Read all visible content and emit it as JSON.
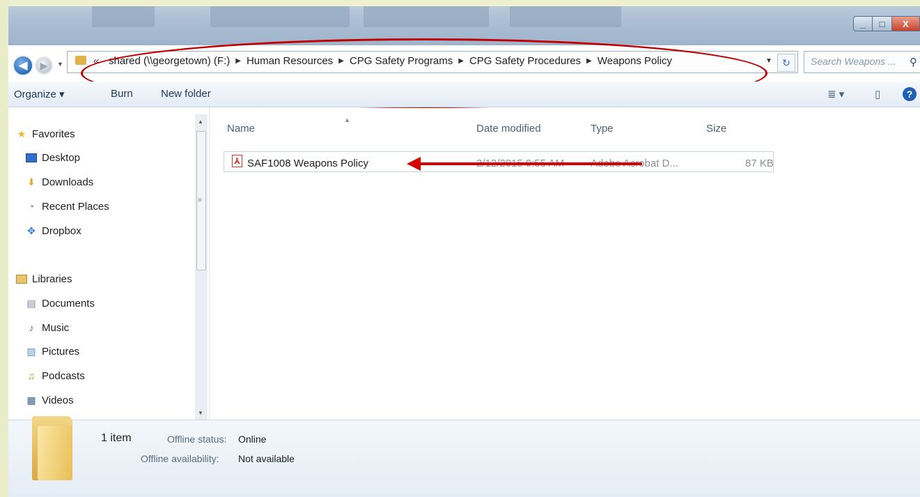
{
  "address": {
    "chevrons": "«",
    "segments": [
      "shared (\\\\georgetown) (F:)",
      "Human Resources",
      "CPG Safety Programs",
      "CPG Safety Procedures",
      "Weapons Policy"
    ],
    "search_placeholder": "Search Weapons ..."
  },
  "window_controls": {
    "minimize": "_",
    "maximize": "□",
    "close": "X"
  },
  "toolbar": {
    "organize": "Organize ▾",
    "burn": "Burn",
    "new_folder": "New folder",
    "views": "≣ ▾",
    "preview": "▯",
    "help": "?"
  },
  "nav": {
    "favorites": {
      "label": "Favorites",
      "items": [
        "Desktop",
        "Downloads",
        "Recent Places",
        "Dropbox"
      ]
    },
    "libraries": {
      "label": "Libraries",
      "items": [
        "Documents",
        "Music",
        "Pictures",
        "Podcasts",
        "Videos"
      ]
    }
  },
  "columns": {
    "name": "Name",
    "date": "Date modified",
    "type": "Type",
    "size": "Size"
  },
  "files": [
    {
      "name": "SAF1008 Weapons Policy",
      "date": "2/12/2015 9:55 AM",
      "type": "Adobe Acrobat D...",
      "size": "87 KB"
    }
  ],
  "details": {
    "count": "1 item",
    "status_label": "Offline status:",
    "status_value": "Online",
    "availability_label": "Offline availability:",
    "availability_value": "Not available"
  },
  "colors": {
    "annotation": "#c00000",
    "accent": "#1f5fb4"
  }
}
